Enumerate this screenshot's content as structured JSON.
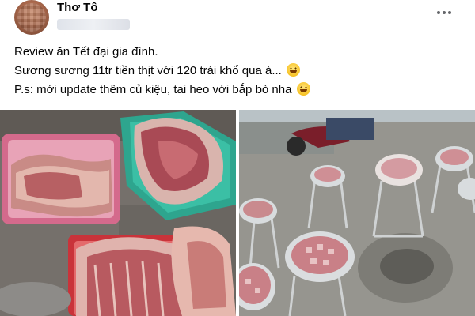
{
  "post": {
    "author": "Thơ Tô",
    "caption_lines": [
      "Review ăn Tết đại gia đình.",
      "Sương sương 11tr tiền thịt với 120 trái khổ qua à...",
      "P.s: mới update thêm củ kiệu, tai heo với bắp bò nha"
    ],
    "emoji": "grinning-face-emoji",
    "more_icon": "more-horizontal-icon",
    "photos": [
      {
        "name": "pork-in-baskets-photo"
      },
      {
        "name": "meat-bowls-on-stands-photo"
      }
    ]
  }
}
